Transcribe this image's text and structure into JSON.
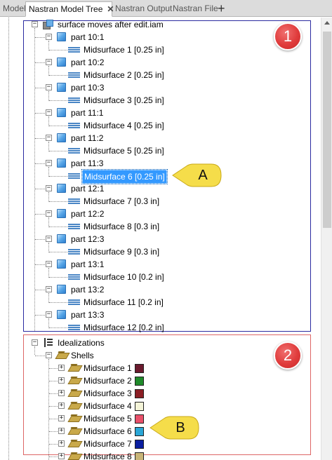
{
  "tabs": [
    {
      "label": "Model",
      "active": false
    },
    {
      "label": "Nastran Model Tree",
      "active": true
    },
    {
      "label": "Nastran Output",
      "active": false
    },
    {
      "label": "Nastran File",
      "active": false
    }
  ],
  "tab_close_glyph": "✕",
  "tab_add_glyph": "+",
  "tree": {
    "assembly_label": "surface moves after edit.iam",
    "parts": [
      {
        "part": "part 10:1",
        "surface": "Midsurface 1 [0.25 in]"
      },
      {
        "part": "part 10:2",
        "surface": "Midsurface 2 [0.25 in]"
      },
      {
        "part": "part 10:3",
        "surface": "Midsurface 3 [0.25 in]"
      },
      {
        "part": "part 11:1",
        "surface": "Midsurface 4 [0.25 in]"
      },
      {
        "part": "part 11:2",
        "surface": "Midsurface 5 [0.25 in]"
      },
      {
        "part": "part 11:3",
        "surface": "Midsurface 6 [0.25 in]",
        "selected": true
      },
      {
        "part": "part 12:1",
        "surface": "Midsurface 7 [0.3 in]"
      },
      {
        "part": "part 12:2",
        "surface": "Midsurface 8 [0.3 in]"
      },
      {
        "part": "part 12:3",
        "surface": "Midsurface 9 [0.3 in]"
      },
      {
        "part": "part 13:1",
        "surface": "Midsurface 10 [0.2 in]"
      },
      {
        "part": "part 13:2",
        "surface": "Midsurface 11 [0.2 in]"
      },
      {
        "part": "part 13:3",
        "surface": "Midsurface 12 [0.2 in]"
      }
    ],
    "idealizations_label": "Idealizations",
    "shells_label": "Shells",
    "shells": [
      {
        "label": "Midsurface 1",
        "color": "#6b1a2e"
      },
      {
        "label": "Midsurface 2",
        "color": "#1f8a2a"
      },
      {
        "label": "Midsurface 3",
        "color": "#8b1e24"
      },
      {
        "label": "Midsurface 4",
        "color": "#f4f4d8"
      },
      {
        "label": "Midsurface 5",
        "color": "#e8506a"
      },
      {
        "label": "Midsurface 6",
        "color": "#2aa6d6"
      },
      {
        "label": "Midsurface 7",
        "color": "#0a1ea0"
      },
      {
        "label": "Midsurface 8",
        "color": "#c8b478"
      }
    ]
  },
  "annotations": {
    "badge_1": "1",
    "badge_2": "2",
    "callout_a": "A",
    "callout_b": "B",
    "badge_color": "#e03c3c",
    "callout_color": "#f5dd4a",
    "box_top_color": "#2a2aa0",
    "box_bottom_color": "#dd6666"
  }
}
